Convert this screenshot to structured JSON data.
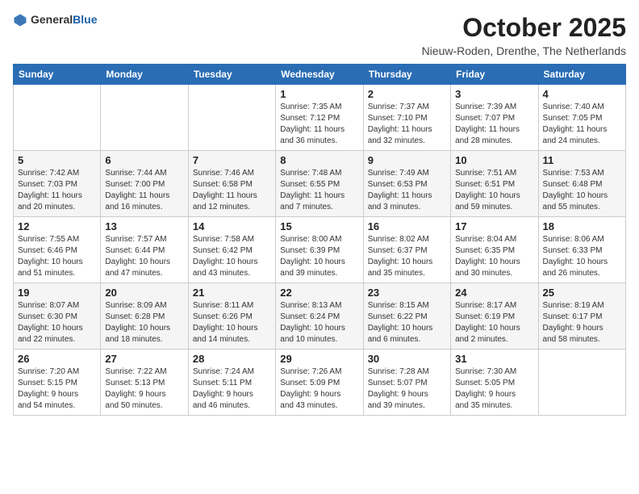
{
  "header": {
    "logo_general": "General",
    "logo_blue": "Blue",
    "title": "October 2025",
    "location": "Nieuw-Roden, Drenthe, The Netherlands"
  },
  "weekdays": [
    "Sunday",
    "Monday",
    "Tuesday",
    "Wednesday",
    "Thursday",
    "Friday",
    "Saturday"
  ],
  "weeks": [
    [
      {
        "day": "",
        "info": ""
      },
      {
        "day": "",
        "info": ""
      },
      {
        "day": "",
        "info": ""
      },
      {
        "day": "1",
        "info": "Sunrise: 7:35 AM\nSunset: 7:12 PM\nDaylight: 11 hours\nand 36 minutes."
      },
      {
        "day": "2",
        "info": "Sunrise: 7:37 AM\nSunset: 7:10 PM\nDaylight: 11 hours\nand 32 minutes."
      },
      {
        "day": "3",
        "info": "Sunrise: 7:39 AM\nSunset: 7:07 PM\nDaylight: 11 hours\nand 28 minutes."
      },
      {
        "day": "4",
        "info": "Sunrise: 7:40 AM\nSunset: 7:05 PM\nDaylight: 11 hours\nand 24 minutes."
      }
    ],
    [
      {
        "day": "5",
        "info": "Sunrise: 7:42 AM\nSunset: 7:03 PM\nDaylight: 11 hours\nand 20 minutes."
      },
      {
        "day": "6",
        "info": "Sunrise: 7:44 AM\nSunset: 7:00 PM\nDaylight: 11 hours\nand 16 minutes."
      },
      {
        "day": "7",
        "info": "Sunrise: 7:46 AM\nSunset: 6:58 PM\nDaylight: 11 hours\nand 12 minutes."
      },
      {
        "day": "8",
        "info": "Sunrise: 7:48 AM\nSunset: 6:55 PM\nDaylight: 11 hours\nand 7 minutes."
      },
      {
        "day": "9",
        "info": "Sunrise: 7:49 AM\nSunset: 6:53 PM\nDaylight: 11 hours\nand 3 minutes."
      },
      {
        "day": "10",
        "info": "Sunrise: 7:51 AM\nSunset: 6:51 PM\nDaylight: 10 hours\nand 59 minutes."
      },
      {
        "day": "11",
        "info": "Sunrise: 7:53 AM\nSunset: 6:48 PM\nDaylight: 10 hours\nand 55 minutes."
      }
    ],
    [
      {
        "day": "12",
        "info": "Sunrise: 7:55 AM\nSunset: 6:46 PM\nDaylight: 10 hours\nand 51 minutes."
      },
      {
        "day": "13",
        "info": "Sunrise: 7:57 AM\nSunset: 6:44 PM\nDaylight: 10 hours\nand 47 minutes."
      },
      {
        "day": "14",
        "info": "Sunrise: 7:58 AM\nSunset: 6:42 PM\nDaylight: 10 hours\nand 43 minutes."
      },
      {
        "day": "15",
        "info": "Sunrise: 8:00 AM\nSunset: 6:39 PM\nDaylight: 10 hours\nand 39 minutes."
      },
      {
        "day": "16",
        "info": "Sunrise: 8:02 AM\nSunset: 6:37 PM\nDaylight: 10 hours\nand 35 minutes."
      },
      {
        "day": "17",
        "info": "Sunrise: 8:04 AM\nSunset: 6:35 PM\nDaylight: 10 hours\nand 30 minutes."
      },
      {
        "day": "18",
        "info": "Sunrise: 8:06 AM\nSunset: 6:33 PM\nDaylight: 10 hours\nand 26 minutes."
      }
    ],
    [
      {
        "day": "19",
        "info": "Sunrise: 8:07 AM\nSunset: 6:30 PM\nDaylight: 10 hours\nand 22 minutes."
      },
      {
        "day": "20",
        "info": "Sunrise: 8:09 AM\nSunset: 6:28 PM\nDaylight: 10 hours\nand 18 minutes."
      },
      {
        "day": "21",
        "info": "Sunrise: 8:11 AM\nSunset: 6:26 PM\nDaylight: 10 hours\nand 14 minutes."
      },
      {
        "day": "22",
        "info": "Sunrise: 8:13 AM\nSunset: 6:24 PM\nDaylight: 10 hours\nand 10 minutes."
      },
      {
        "day": "23",
        "info": "Sunrise: 8:15 AM\nSunset: 6:22 PM\nDaylight: 10 hours\nand 6 minutes."
      },
      {
        "day": "24",
        "info": "Sunrise: 8:17 AM\nSunset: 6:19 PM\nDaylight: 10 hours\nand 2 minutes."
      },
      {
        "day": "25",
        "info": "Sunrise: 8:19 AM\nSunset: 6:17 PM\nDaylight: 9 hours\nand 58 minutes."
      }
    ],
    [
      {
        "day": "26",
        "info": "Sunrise: 7:20 AM\nSunset: 5:15 PM\nDaylight: 9 hours\nand 54 minutes."
      },
      {
        "day": "27",
        "info": "Sunrise: 7:22 AM\nSunset: 5:13 PM\nDaylight: 9 hours\nand 50 minutes."
      },
      {
        "day": "28",
        "info": "Sunrise: 7:24 AM\nSunset: 5:11 PM\nDaylight: 9 hours\nand 46 minutes."
      },
      {
        "day": "29",
        "info": "Sunrise: 7:26 AM\nSunset: 5:09 PM\nDaylight: 9 hours\nand 43 minutes."
      },
      {
        "day": "30",
        "info": "Sunrise: 7:28 AM\nSunset: 5:07 PM\nDaylight: 9 hours\nand 39 minutes."
      },
      {
        "day": "31",
        "info": "Sunrise: 7:30 AM\nSunset: 5:05 PM\nDaylight: 9 hours\nand 35 minutes."
      },
      {
        "day": "",
        "info": ""
      }
    ]
  ]
}
